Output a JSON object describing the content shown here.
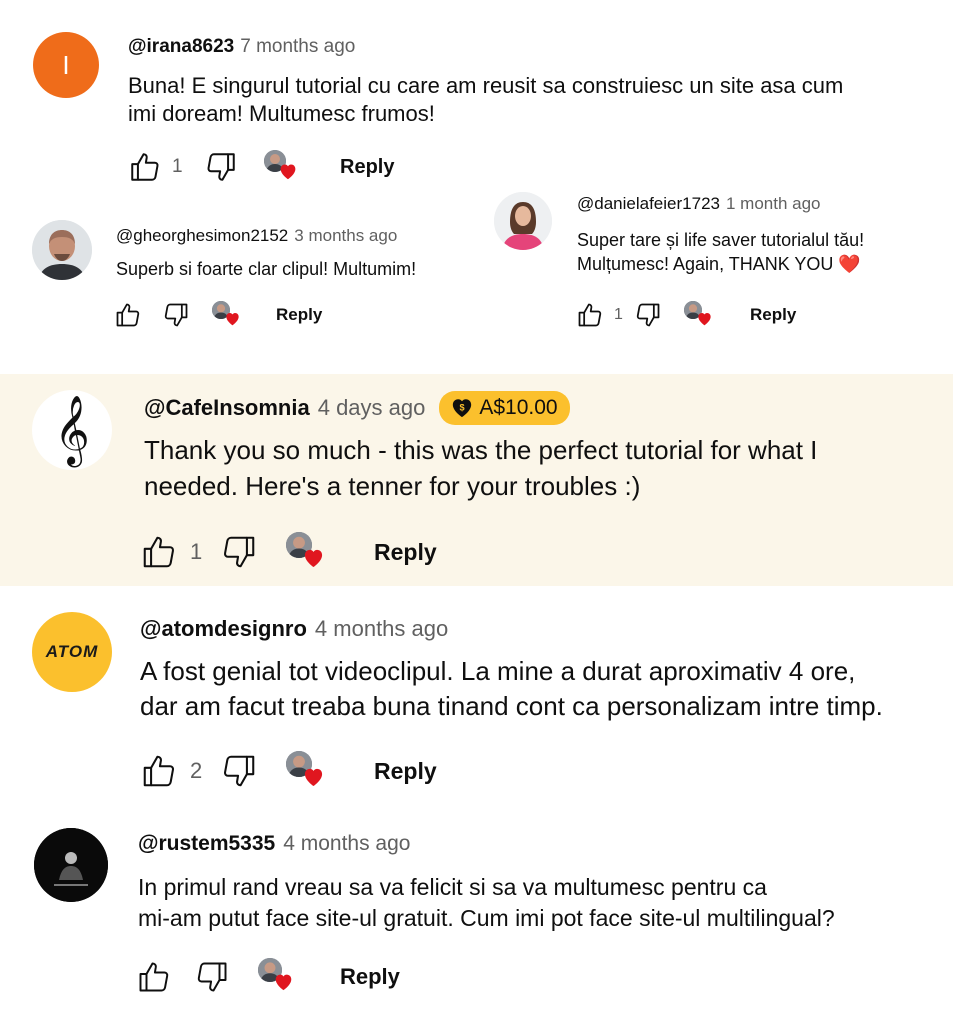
{
  "comments": [
    {
      "handle": "@irana8623",
      "time": "7 months ago",
      "avatar_letter": "I",
      "avatar_color": "#ef6c1a",
      "lines": [
        "Buna! E singurul tutorial cu care am reusit sa construiesc un site asa cum",
        "imi doream! Multumesc frumos!"
      ],
      "likes": "1",
      "reply_label": "Reply"
    },
    {
      "handle": "@gheorghesimon2152",
      "time": "3 months ago",
      "lines": [
        "Superb si foarte clar clipul! Multumim!"
      ],
      "likes": "",
      "reply_label": "Reply"
    },
    {
      "handle": "@danielafeier1723",
      "time": "1 month ago",
      "lines": [
        "Super tare și life saver tutorialul tău!",
        "Mulțumesc! Again, THANK YOU ❤️"
      ],
      "likes": "1",
      "reply_label": "Reply"
    },
    {
      "handle": "@CafeInsomnia",
      "time": "4 days ago",
      "super_thanks": "A$10.00",
      "avatar_glyph": "𝄞",
      "lines": [
        "Thank you so much - this was the perfect tutorial for what I",
        "needed. Here's a tenner for your troubles :)"
      ],
      "likes": "1",
      "reply_label": "Reply"
    },
    {
      "handle": "@atomdesignro",
      "time": "4 months ago",
      "avatar_text": "ATOM",
      "avatar_color": "#fbc02d",
      "lines": [
        "A fost genial tot videoclipul. La mine a durat aproximativ 4 ore,",
        "dar am facut treaba buna tinand cont ca personalizam intre timp."
      ],
      "likes": "2",
      "reply_label": "Reply"
    },
    {
      "handle": "@rustem5335",
      "time": "4 months ago",
      "lines": [
        "In primul rand vreau sa va felicit si sa va multumesc pentru ca",
        "mi-am putut face site-ul gratuit. Cum imi pot face site-ul multilingual?"
      ],
      "likes": "",
      "reply_label": "Reply"
    }
  ],
  "colors": {
    "text": "#0f0f0f",
    "secondary": "#606060",
    "super_thanks_bg": "#fbf6e9",
    "super_thanks_badge": "#fbc02d",
    "heart": "#e0161f"
  },
  "icons": [
    "thumbs-up-icon",
    "thumbs-down-icon",
    "creator-heart-icon",
    "super-thanks-dollar-icon"
  ]
}
